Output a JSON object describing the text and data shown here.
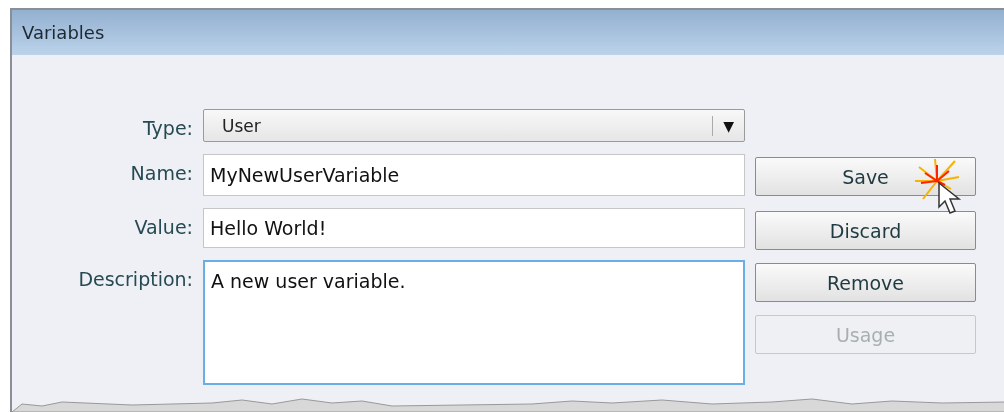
{
  "window": {
    "title": "Variables"
  },
  "fields": [
    {
      "kind": "dropdown",
      "label": "Type:",
      "value": "User",
      "arrow": "▼"
    },
    {
      "kind": "text",
      "label": "Name:",
      "value": "MyNewUserVariable"
    },
    {
      "kind": "text",
      "label": "Value:",
      "value": "Hello World!"
    },
    {
      "kind": "textarea",
      "label": "Description:",
      "value": "A new user variable.",
      "focused": true
    }
  ],
  "buttons": [
    {
      "label": "Save",
      "disabled": false
    },
    {
      "label": "Discard",
      "disabled": false
    },
    {
      "label": "Remove",
      "disabled": false
    },
    {
      "label": "Usage",
      "disabled": true
    }
  ]
}
